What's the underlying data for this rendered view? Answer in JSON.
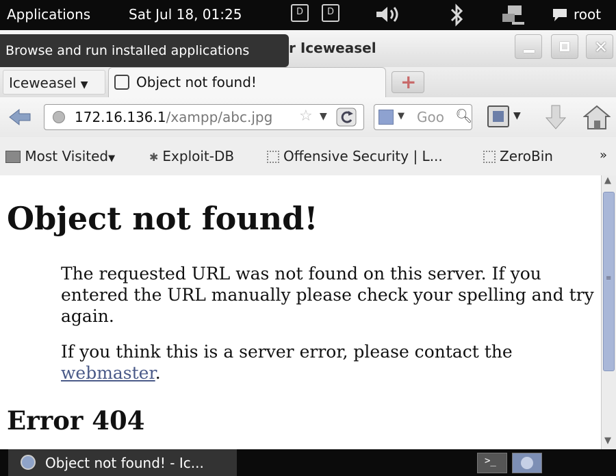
{
  "top_panel": {
    "applications": "Applications",
    "datetime": "Sat Jul 18, 01:25",
    "user": "root"
  },
  "window": {
    "title": "r Iceweasel",
    "tooltip": "Browse and run installed applications"
  },
  "tabs": {
    "app_menu": "Iceweasel",
    "active_tab": "Object not found!"
  },
  "navbar": {
    "url_host": "172.16.136.1",
    "url_path": "/xampp/abc.jpg",
    "search_placeholder": "Goo"
  },
  "bookmarks": {
    "items": [
      "Most Visited",
      "Exploit-DB",
      "Offensive Security | L...",
      "ZeroBin"
    ],
    "overflow": "»"
  },
  "page": {
    "heading": "Object not found!",
    "para1": "The requested URL was not found on this server. If you entered the URL manually please check your spelling and try again.",
    "para2_prefix": "If you think this is a server error, please contact the",
    "para2_link": "webmaster",
    "para2_suffix": ".",
    "subheading": "Error 404"
  },
  "taskbar": {
    "item": "Object not found! - Ic..."
  },
  "colors": {
    "link": "#4a5a88",
    "scroll_thumb": "#a9b7d8",
    "panel": "#0b0b0b"
  }
}
